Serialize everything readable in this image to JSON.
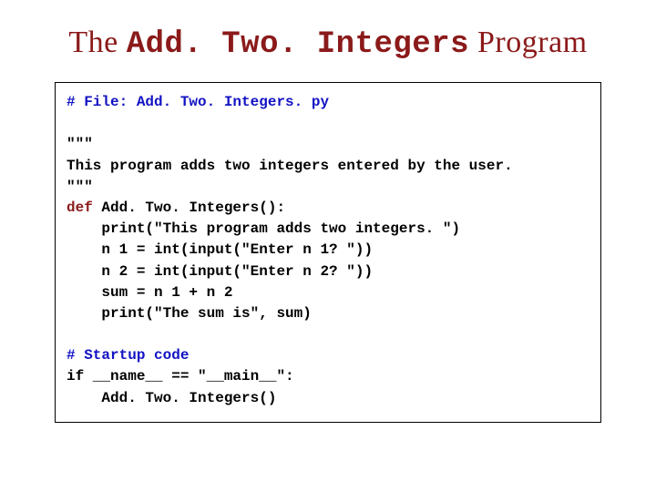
{
  "title_pre": "The ",
  "title_code": "Add. Two. Integers",
  "title_post": " Program",
  "code": {
    "l1": "# File: Add. Two. Integers. py",
    "l2": "\"\"\"",
    "l3": "This program adds two integers entered by the user.",
    "l4": "\"\"\"",
    "l5a": "def ",
    "l5b": "Add. Two. Integers():",
    "l6": "    print(\"This program adds two integers. \")",
    "l7": "    n 1 = int(input(\"Enter n 1? \"))",
    "l8": "    n 2 = int(input(\"Enter n 2? \"))",
    "l9": "    sum = n 1 + n 2",
    "l10": "    print(\"The sum is\", sum)",
    "l11": "# Startup code",
    "l12": "if __name__ == \"__main__\":",
    "l13": "    Add. Two. Integers()"
  }
}
